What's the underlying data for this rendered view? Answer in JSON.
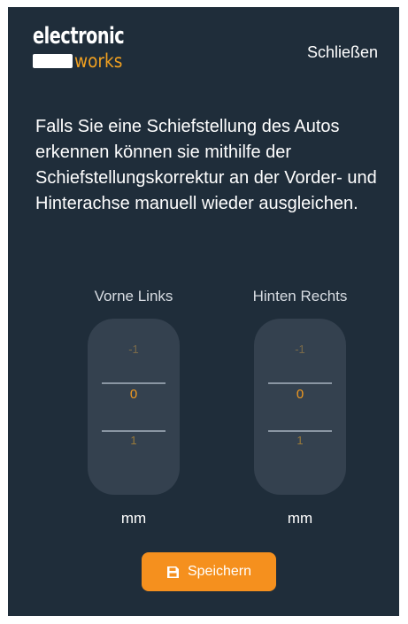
{
  "header": {
    "logo_top": "electronic",
    "logo_bottom": "works",
    "close_label": "Schließen"
  },
  "description": "Falls Sie eine Schiefstellung des Autos erkennen können sie mithilfe der Schiefstellungskorrektur an der Vorder- und Hinterachse manuell wieder ausgleichen.",
  "pickers": [
    {
      "label": "Vorne Links",
      "prev": "-1",
      "value": "0",
      "next": "1",
      "unit": "mm"
    },
    {
      "label": "Hinten Rechts",
      "prev": "-1",
      "value": "0",
      "next": "1",
      "unit": "mm"
    }
  ],
  "save_button": {
    "label": "Speichern",
    "icon": "save-icon"
  },
  "colors": {
    "background": "#1f2d3a",
    "accent": "#f5901e",
    "wheel": "#34414f"
  }
}
